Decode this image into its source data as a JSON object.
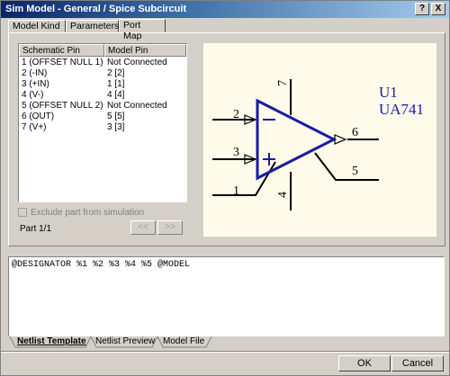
{
  "window": {
    "title": "Sim Model - General / Spice Subcircuit",
    "help": "?",
    "close": "X"
  },
  "top_tabs": [
    {
      "label": "Model Kind"
    },
    {
      "label": "Parameters"
    },
    {
      "label": "Port Map",
      "active": true
    }
  ],
  "pin_table": {
    "headers": [
      "Schematic Pin",
      "Model Pin"
    ],
    "rows": [
      [
        "1 (OFFSET NULL 1)",
        "Not Connected"
      ],
      [
        "2 (-IN)",
        "2 [2]"
      ],
      [
        "3 (+IN)",
        "1 [1]"
      ],
      [
        "4 (V-)",
        "4 [4]"
      ],
      [
        "5 (OFFSET NULL 2)",
        "Not Connected"
      ],
      [
        "6 (OUT)",
        "5 [5]"
      ],
      [
        "7 (V+)",
        "3 [3]"
      ]
    ]
  },
  "exclude_label": "Exclude part from simulation",
  "part_label": "Part 1/1",
  "nav": {
    "prev": "<<",
    "next": ">>"
  },
  "symbol": {
    "designator": "U1",
    "comment": "UA741",
    "pins": {
      "p1": "1",
      "p2": "2",
      "p3": "3",
      "p4": "4",
      "p5": "5",
      "p6": "6",
      "p7": "7"
    },
    "colors": {
      "body": "#1a1aa6",
      "wire": "#000000",
      "text_blue": "#1a1aa6",
      "bg": "#fffbea"
    }
  },
  "netlist_text": "@DESIGNATOR %1 %2 %3 %4 %5 @MODEL",
  "bottom_tabs": [
    {
      "label": "Netlist Template",
      "active": true
    },
    {
      "label": "Netlist Preview"
    },
    {
      "label": "Model File"
    }
  ],
  "buttons": {
    "ok": "OK",
    "cancel": "Cancel"
  }
}
